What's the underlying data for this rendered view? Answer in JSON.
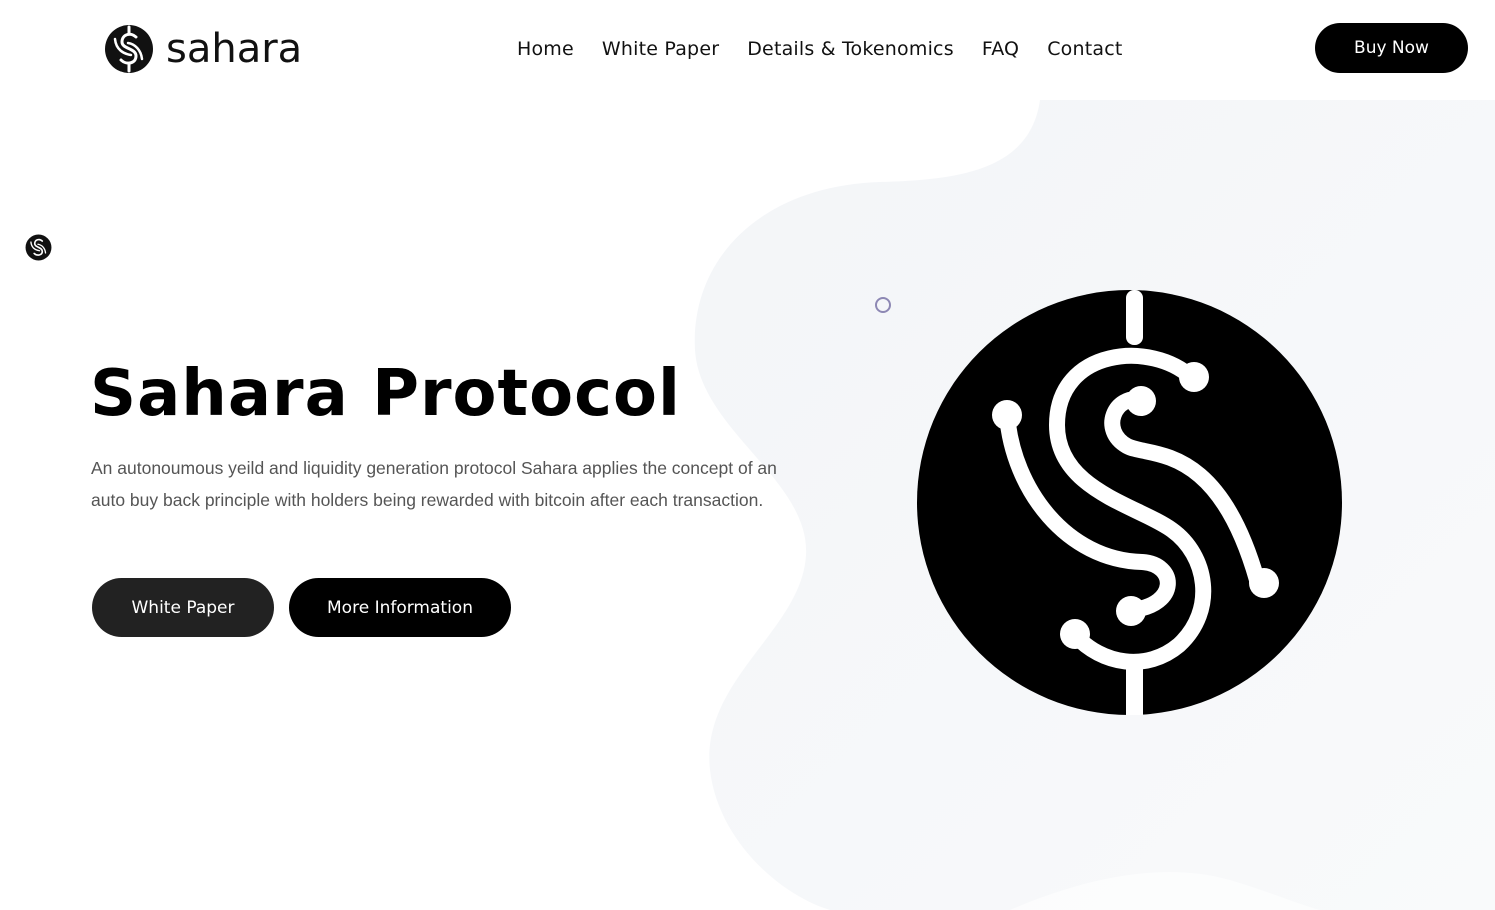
{
  "brand": {
    "name": "sahara",
    "logo_icon": "sahara-dollar-circuit-icon"
  },
  "nav": {
    "items": [
      {
        "label": "Home"
      },
      {
        "label": "White Paper"
      },
      {
        "label": "Details & Tokenomics"
      },
      {
        "label": "FAQ"
      },
      {
        "label": "Contact"
      }
    ]
  },
  "header": {
    "buy_label": "Buy Now"
  },
  "hero": {
    "title": "Sahara Protocol",
    "description": "An autonoumous yeild and liquidity generation protocol Sahara applies the concept of an auto buy back principle with holders being rewarded with bitcoin after each transaction.",
    "primary_button": "White Paper",
    "secondary_button": "More Information"
  },
  "colors": {
    "accent": "#000000",
    "secondary_button": "#222222",
    "text_muted": "#555555",
    "blob": "#f4f6f8",
    "ring": "#8d88b4"
  }
}
